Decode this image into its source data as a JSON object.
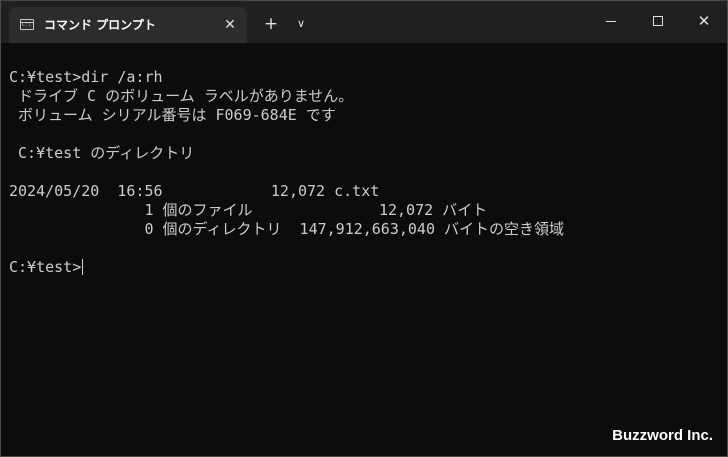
{
  "tab": {
    "title": "コマンド プロンプト",
    "close_glyph": "✕",
    "icon": "cmd-icon"
  },
  "toolbar": {
    "new_tab_glyph": "+",
    "dropdown_glyph": "∨"
  },
  "window_controls": {
    "close_glyph": "✕"
  },
  "console": {
    "lines": [
      "",
      "C:¥test>dir /a:rh",
      " ドライブ C のボリューム ラベルがありません。",
      " ボリューム シリアル番号は F069-684E です",
      "",
      " C:¥test のディレクトリ",
      "",
      "2024/05/20  16:56            12,072 c.txt",
      "               1 個のファイル              12,072 バイト",
      "               0 個のディレクトリ  147,912,663,040 バイトの空き領域",
      "",
      "C:¥test>"
    ]
  },
  "watermark": "Buzzword Inc.",
  "colors": {
    "titlebar": "#202020",
    "tab": "#2c2c2c",
    "console_bg": "#0c0c0c",
    "console_text": "#cccccc"
  }
}
